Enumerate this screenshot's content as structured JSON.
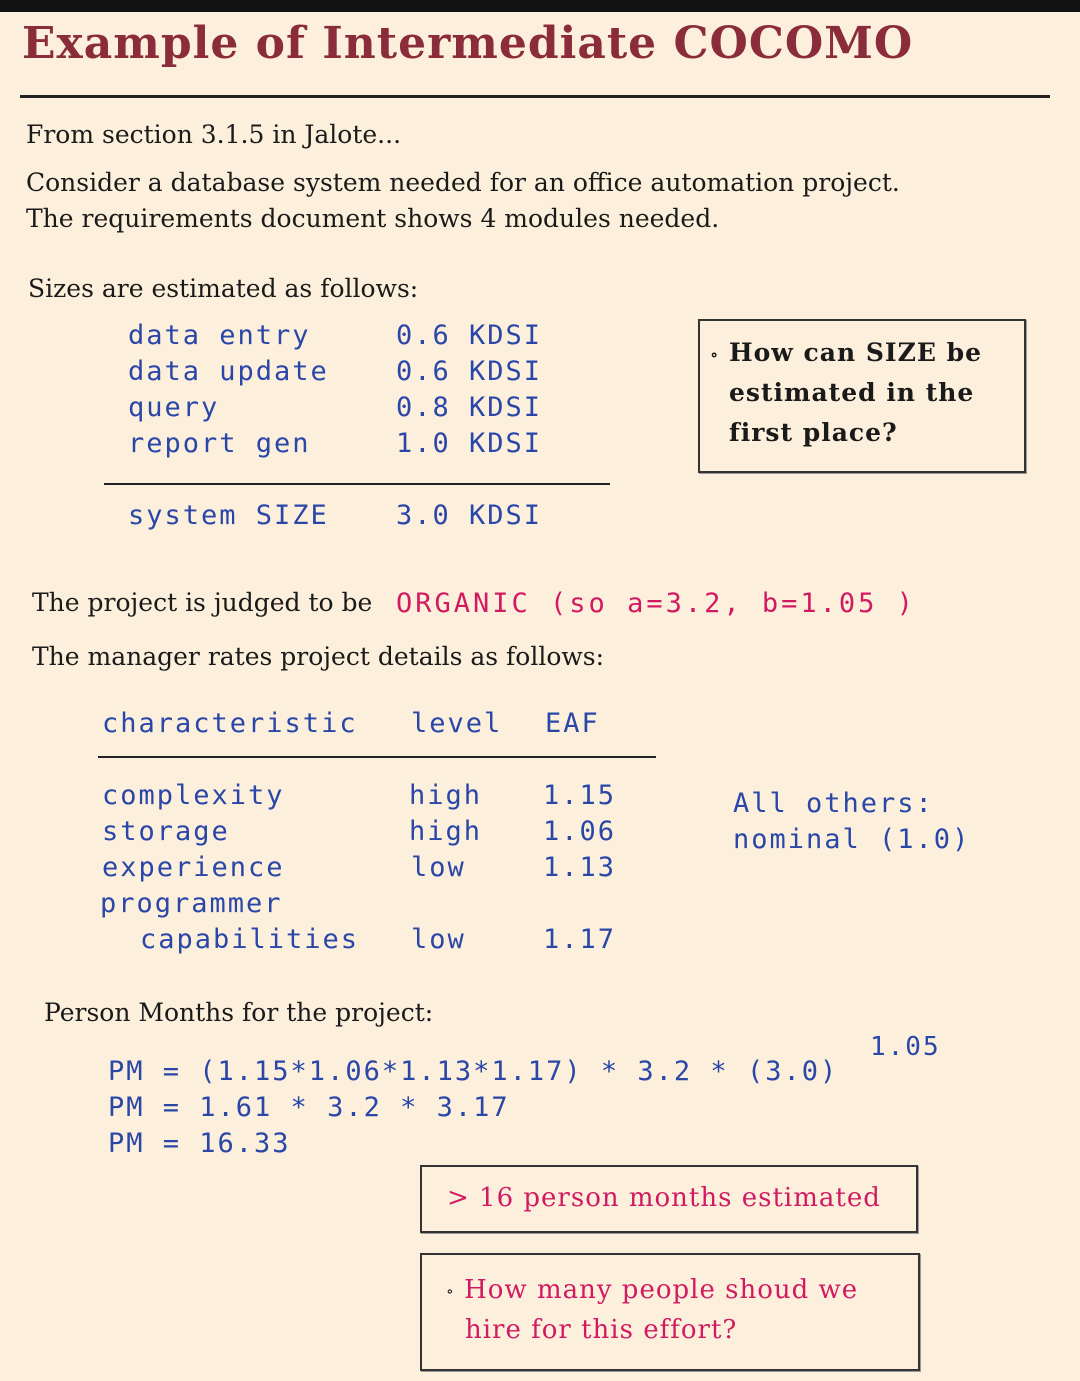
{
  "title": "Example of Intermediate COCOMO",
  "intro": {
    "source": "From section 3.1.5 in Jalote...",
    "line1": "Consider a database system needed for an office automation project.",
    "line2": "The requirements document shows 4 modules needed."
  },
  "sizes": {
    "heading": "Sizes are estimated as follows:",
    "modules": [
      {
        "name": "data entry",
        "size": "0.6 KDSI"
      },
      {
        "name": "data update",
        "size": "0.6 KDSI"
      },
      {
        "name": "query",
        "size": "0.8 KDSI"
      },
      {
        "name": "report gen",
        "size": "1.0 KDSI"
      }
    ],
    "total_label": "system SIZE",
    "total_value": "3.0 KDSI"
  },
  "size_question": {
    "line1": "How can SIZE be",
    "line2": "estimated in the",
    "line3": "first place?"
  },
  "mode": {
    "prefix": "The project is judged to be",
    "value": "ORGANIC (so a=3.2, b=1.05 )"
  },
  "ratings": {
    "heading": "The manager rates project details as follows:",
    "columns": [
      "characteristic",
      "level",
      "EAF"
    ],
    "rows": [
      {
        "characteristic": "complexity",
        "level": "high",
        "eaf": "1.15"
      },
      {
        "characteristic": "storage",
        "level": "high",
        "eaf": "1.06"
      },
      {
        "characteristic": "experience",
        "level": "low",
        "eaf": "1.13"
      },
      {
        "characteristic": "programmer",
        "level": "",
        "eaf": ""
      },
      {
        "characteristic": "capabilities",
        "level": "low",
        "eaf": "1.17"
      }
    ],
    "others_line1": "All others:",
    "others_line2": "nominal (1.0)"
  },
  "pm": {
    "heading": "Person Months for the project:",
    "exponent": "1.05",
    "line1": "PM = (1.15*1.06*1.13*1.17) * 3.2 * (3.0)",
    "line2": "PM = 1.61 * 3.2 * 3.17",
    "line3": "PM = 16.33"
  },
  "result_box": "> 16 person months estimated",
  "people_question": {
    "line1": "How many people shoud we",
    "line2": "hire for this effort?"
  }
}
